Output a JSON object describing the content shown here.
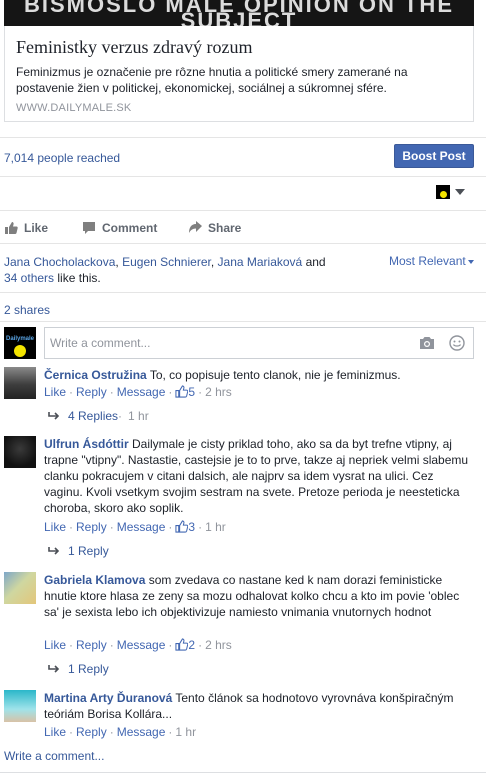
{
  "preview": {
    "image_text_line1": "BISMOSLO MALE OPINION ON THE",
    "image_text_line2": "SUBJECT",
    "title": "Feministky verzus zdravý rozum",
    "description": "Feminizmus je označenie pre rôzne hnutia a politické smery zamerané na postavenie žien v politickej, ekonomickej, sociálnej a súkromnej sfére.",
    "domain": "WWW.DAILYMALE.SK"
  },
  "stats": {
    "reached": "7,014 people reached",
    "boost_label": "Boost Post"
  },
  "actions": {
    "like": "Like",
    "comment": "Comment",
    "share": "Share"
  },
  "likes": {
    "name1": "Jana Chocholackova",
    "name2": "Eugen Schnierer",
    "name3": "Jana Mariaková",
    "and": "and",
    "others": "34 others",
    "suffix": "like this.",
    "comma": ","
  },
  "sort_label": "Most Relevant",
  "shares": "2 shares",
  "composer": {
    "avatar_text": "Dailymale",
    "placeholder": "Write a comment..."
  },
  "meta_labels": {
    "like": "Like",
    "reply": "Reply",
    "message": "Message"
  },
  "comments": [
    {
      "author": "Černica Ostružina",
      "text": "To, co popisuje tento clanok, nie je feminizmus.",
      "likes": "5",
      "time": "2 hrs",
      "replies": "4 Replies",
      "replies_time": "1 hr"
    },
    {
      "author": "Ulfrun Ásdóttir",
      "text": "Dailymale je cisty priklad toho, ako sa da byt trefne vtipny, aj trapne \"vtipny\". Nastastie, castejsie je to to prve, takze aj nepriek velmi slabemu clanku pokracujem v citani dalsich, ale najprv sa idem vysrat na ulici. Cez vaginu. Kvoli vsetkym svojim sestram na svete. Pretoze perioda je neesteticka choroba, skoro ako soplik.",
      "likes": "3",
      "time": "1 hr",
      "replies": "1 Reply"
    },
    {
      "author": "Gabriela Klamova",
      "text": "som zvedava co nastane ked k nam dorazi feministicke hnutie ktore hlasa ze zeny sa mozu odhalovat kolko chcu a kto im povie 'oblec sa' je sexista lebo ich objektivizuje namiesto vnimania vnutornych hodnot",
      "likes": "2",
      "time": "2 hrs",
      "replies": "1 Reply"
    },
    {
      "author": "Martina Arty Ďuranová",
      "text": "Tento článok sa hodnotovo vyrovnáva konšpiračným teóriám Borisa Kollára...",
      "time": "1 hr"
    }
  ],
  "write_comment": "Write a comment...",
  "colors": {
    "link": "#365899",
    "boost_button": "#4267b2",
    "muted": "#90949c",
    "brand_yellow": "#f4e400"
  }
}
